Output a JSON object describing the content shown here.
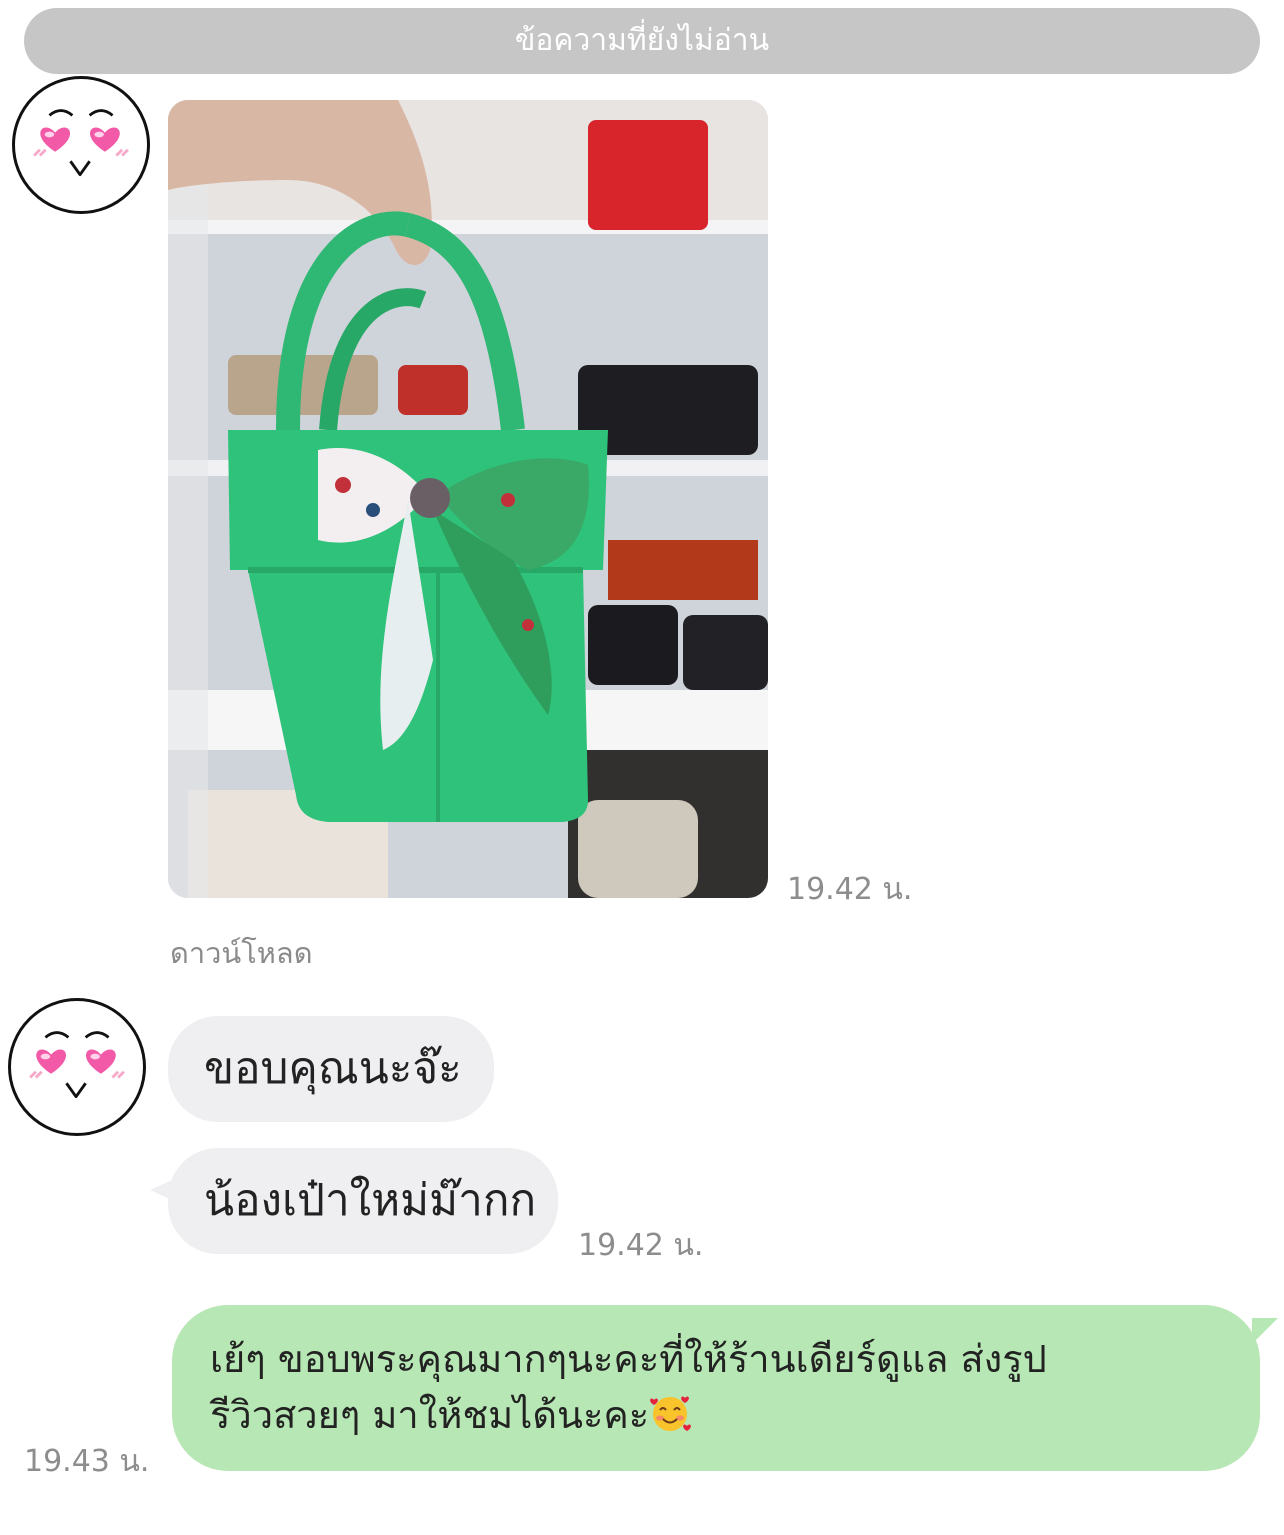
{
  "unread_banner": "ข้อความที่ยังไม่อ่าน",
  "messages": {
    "photo_time": "19.42 น.",
    "download_label": "ดาวน์โหลด",
    "incoming_1": "ขอบคุณนะจ๊ะ",
    "incoming_2": "น้องเป๋าใหม่ม๊ากก",
    "incoming_time": "19.42 น.",
    "outgoing_line1": "เย้ๆ ขอบพระคุณมากๆนะคะที่ให้ร้านเดียร์ดูแล ส่งรูป",
    "outgoing_line2": "รีวิวสวยๆ มาให้ชมได้นะคะ",
    "outgoing_time": "19.43 น."
  },
  "icons": {
    "avatar": "heart-eyes-face-icon",
    "emoji": "smiling-face-with-hearts-icon"
  },
  "colors": {
    "incoming_bubble": "#efeff1",
    "outgoing_bubble": "#b7e7b4",
    "banner": "#c6c6c6",
    "bag": "#2fc27a",
    "heart": "#f25aa8"
  }
}
